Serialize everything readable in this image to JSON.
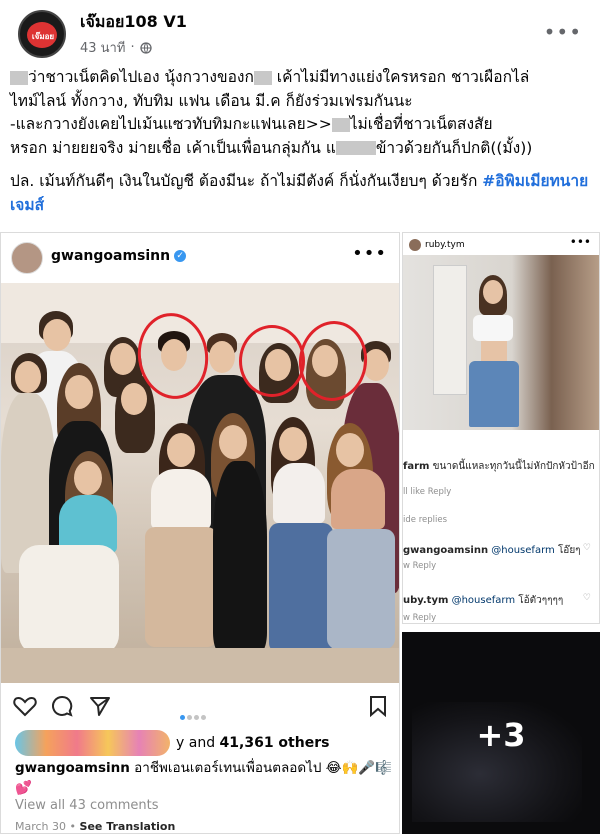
{
  "post": {
    "page_name": "เจ๊มอย108 V1",
    "time": "43 นาที",
    "avatar_text": "เจ๊มอย",
    "line1_a": "ว่าชาวเน็ตคิดไปเอง นุ้งกวางของก",
    "line1_b": "เค้าไม่มีทางแย่งใครหรอก ชาวเผือกไล่",
    "line2": "ไทม์ไลน์ ทั้งกวาง, ทับทิม แฟน เดือน มี.ค ก็ยังร่วมเฟรมกันนะ",
    "line3_a": "-และกวางยังเคยไปเม้นแซวทับทิมกะแฟนเลย>>",
    "line3_b": "ไม่เชื่อที่ชาวเน็ตสงสัย",
    "line4_a": "หรอก ม่ายยยจริง ม่ายเชื่อ เค้าเป็นเพื่อนกลุ่มกัน แ",
    "line4_b": "ข้าวด้วยกันก็ปกติ((มั้ง))",
    "para2": "ปล. เม้นท์กันดีๆ เงินในบัญชี ต้องมีนะ ถ้าไม่มีตังค์ ก็นั่งกันเงียบๆ ด้วยรัก",
    "hashtag": "#อิพิมเมียทนายเจมส์"
  },
  "ig_left": {
    "username": "gwangoamsinn",
    "likes_suffix": "y and",
    "likes_count": "41,361 others",
    "caption_user": "gwangoamsinn",
    "caption_text": "อาชีพเอนเตอร์เทนเพื่อนตลอดไป 😂🙌🎤🎼💕",
    "view_comments": "View all 43 comments",
    "date": "March 30",
    "see_translation": "See Translation"
  },
  "ig_right": {
    "username": "ruby.tym",
    "c1_user": "farm",
    "c1_text": "ขนาดนี้แหละทุกวันนี้ไม่หักปักหัวป้าอีก",
    "c1_meta": "ll like   Reply",
    "hide_replies": "ide replies",
    "c2_user": "gwangoamsinn",
    "c2_mention": "@housefarm",
    "c2_text": "โอ๊ยๆ",
    "c2_meta": "w   Reply",
    "c3_user": "uby.tym",
    "c3_mention": "@housefarm",
    "c3_text": "โอ้ตัวๆๆๆๆ",
    "c3_meta": "w   Reply"
  },
  "more_photos": "+3",
  "colors": {
    "accent": "#216fdb",
    "ig_blue": "#3897f0",
    "circle_red": "#e0222a"
  }
}
